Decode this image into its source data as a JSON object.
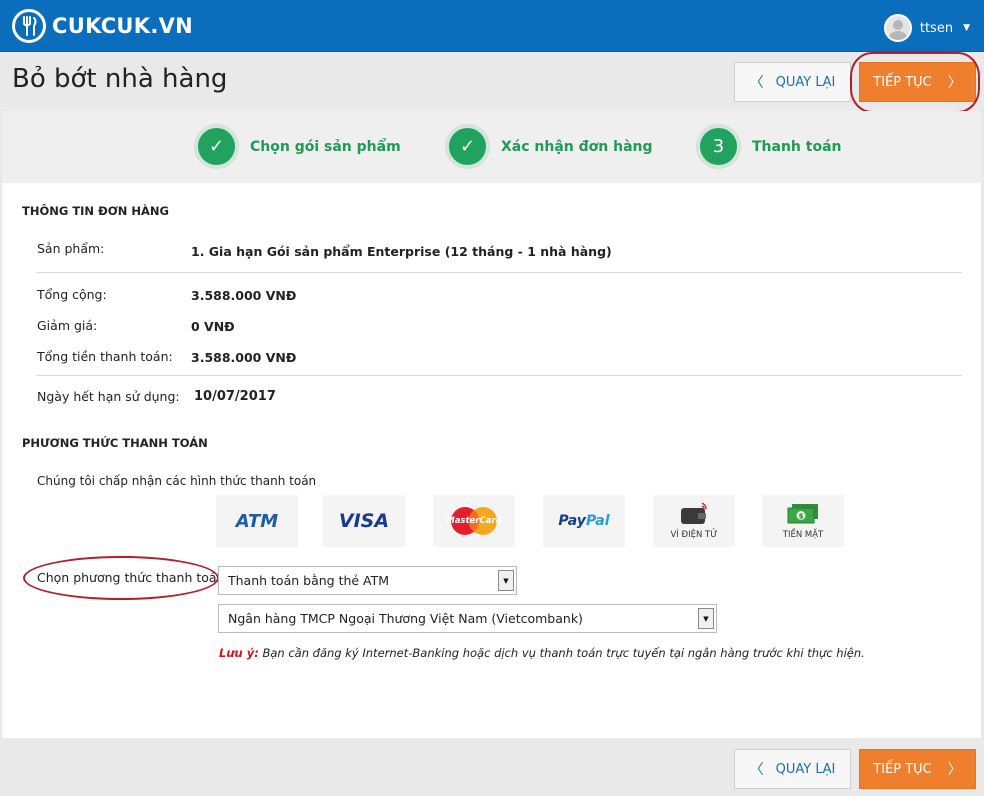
{
  "header": {
    "brand": "CUKCUK.VN",
    "username": "ttsen",
    "brand_color": "#0a6ebd"
  },
  "page": {
    "title": "Bỏ bớt nhà hàng",
    "back_label": "QUAY LẠI",
    "next_label": "TIẾP TỤC",
    "accent_color": "#f07f2d"
  },
  "steps": [
    {
      "marker": "✓",
      "label": "Chọn gói sản phẩm",
      "status": "done"
    },
    {
      "marker": "✓",
      "label": "Xác nhận đơn hàng",
      "status": "done"
    },
    {
      "marker": "3",
      "label": "Thanh toán",
      "status": "current"
    }
  ],
  "order": {
    "heading": "THÔNG TIN ĐƠN HÀNG",
    "product_label": "Sản phẩm:",
    "product_value": "1. Gia hạn Gói sản phẩm Enterprise (12 tháng - 1 nhà hàng)",
    "total_label": "Tổng cộng:",
    "total_value": "3.588.000 VNĐ",
    "discount_label": "Giảm giá:",
    "discount_value": "0 VNĐ",
    "pay_total_label": "Tổng tiền thanh toán:",
    "pay_total_value": "3.588.000 VNĐ",
    "expiry_label": "Ngày hết hạn sử dụng:",
    "expiry_value": "10/07/2017"
  },
  "payment": {
    "heading": "PHƯƠNG THỨC THANH TOÁN",
    "accept_text": "Chúng tôi chấp nhận các hình thức thanh toán",
    "methods": {
      "atm": "ATM",
      "visa": "VISA",
      "mastercard": "MasterCard",
      "paypal_a": "Pay",
      "paypal_b": "Pal",
      "ewallet": "VÍ ĐIỆN TỬ",
      "cash": "TIỀN MẶT"
    },
    "choose_label": "Chọn phương thức thanh toán",
    "method_selected": "Thanh toán bằng thẻ ATM",
    "bank_selected": "Ngân hàng TMCP Ngoại Thương Việt Nam (Vietcombank)",
    "note_prefix": "Lưu ý:",
    "note_text": " Bạn cần đăng ký Internet-Banking hoặc dịch vụ thanh toán trực tuyến tại ngân hàng trước khi thực hiện."
  }
}
